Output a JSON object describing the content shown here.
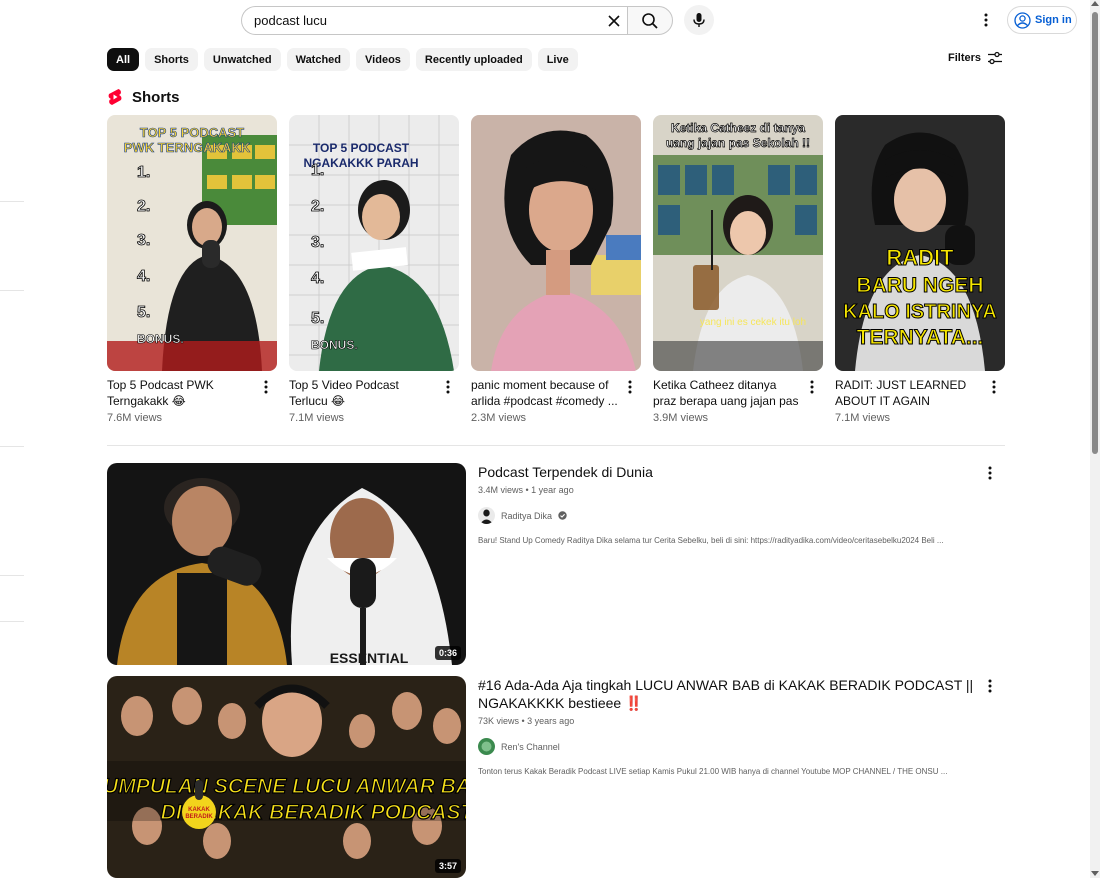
{
  "search": {
    "query": "podcast lucu"
  },
  "header": {
    "sign_in_label": "Sign in"
  },
  "chips": [
    "All",
    "Shorts",
    "Unwatched",
    "Watched",
    "Videos",
    "Recently uploaded",
    "Live"
  ],
  "filters_label": "Filters",
  "shorts": {
    "heading": "Shorts",
    "items": [
      {
        "title": "Top 5 Podcast PWK Terngakakk 😂",
        "views": "7.6M views"
      },
      {
        "title": "Top 5 Video Podcast Terlucu 😂",
        "views": "7.1M views"
      },
      {
        "title": "panic moment because of arlida #podcast #comedy ...",
        "views": "2.3M views"
      },
      {
        "title": "Ketika Catheez ditanya praz berapa uang jajan pas ...",
        "views": "3.9M views"
      },
      {
        "title": "RADIT: JUST LEARNED ABOUT IT AGAIN #podcas...",
        "views": "7.1M views"
      }
    ]
  },
  "videos": [
    {
      "title": "Podcast Terpendek di Dunia",
      "stats": "3.4M views • 1 year ago",
      "channel": "Raditya Dika",
      "verified": true,
      "description": "Baru! Stand Up Comedy Raditya Dika selama tur Cerita Sebelku, beli di sini: https://radityadika.com/video/ceritasebelku2024 Beli ...",
      "duration": "0:36"
    },
    {
      "title": "#16 Ada-Ada Aja tingkah LUCU ANWAR BAB di KAKAK BERADIK PODCAST || NGAKAKKKK bestieee ‼️",
      "stats": "73K views • 3 years ago",
      "channel": "Ren's Channel",
      "verified": false,
      "description": "Tonton terus Kakak Beradik Podcast LIVE setiap Kamis Pukul 21.00 WIB hanya di channel Youtube MOP CHANNEL / THE ONSU ...",
      "duration": "3:57"
    }
  ],
  "colors": {
    "accent_blue": "#065fd4",
    "shorts_red": "#ff0033",
    "chip_bg": "#f2f2f2"
  }
}
